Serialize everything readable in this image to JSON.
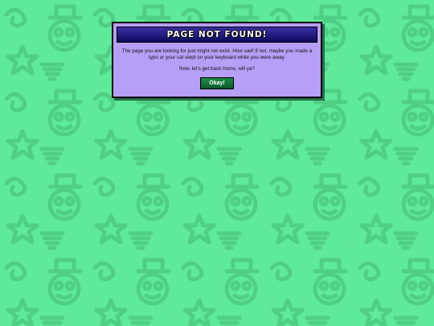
{
  "dialog": {
    "title": "PAGE NOT FOUND!",
    "message_before_em": "The page you are looking for just might not exist. ",
    "message_em": "How sad!",
    "message_after_em": " If not, maybe you made a typo or your cat slept on your keyboard while you were away.",
    "message_second": "Now, let's get back home, will ya?",
    "okay_label": "Okay!"
  },
  "colors": {
    "background": "#5fe99a",
    "pattern": "#4fcf86",
    "dialog": "#b69ff6",
    "title_bar": "#1b1480",
    "button": "#167a3c"
  }
}
